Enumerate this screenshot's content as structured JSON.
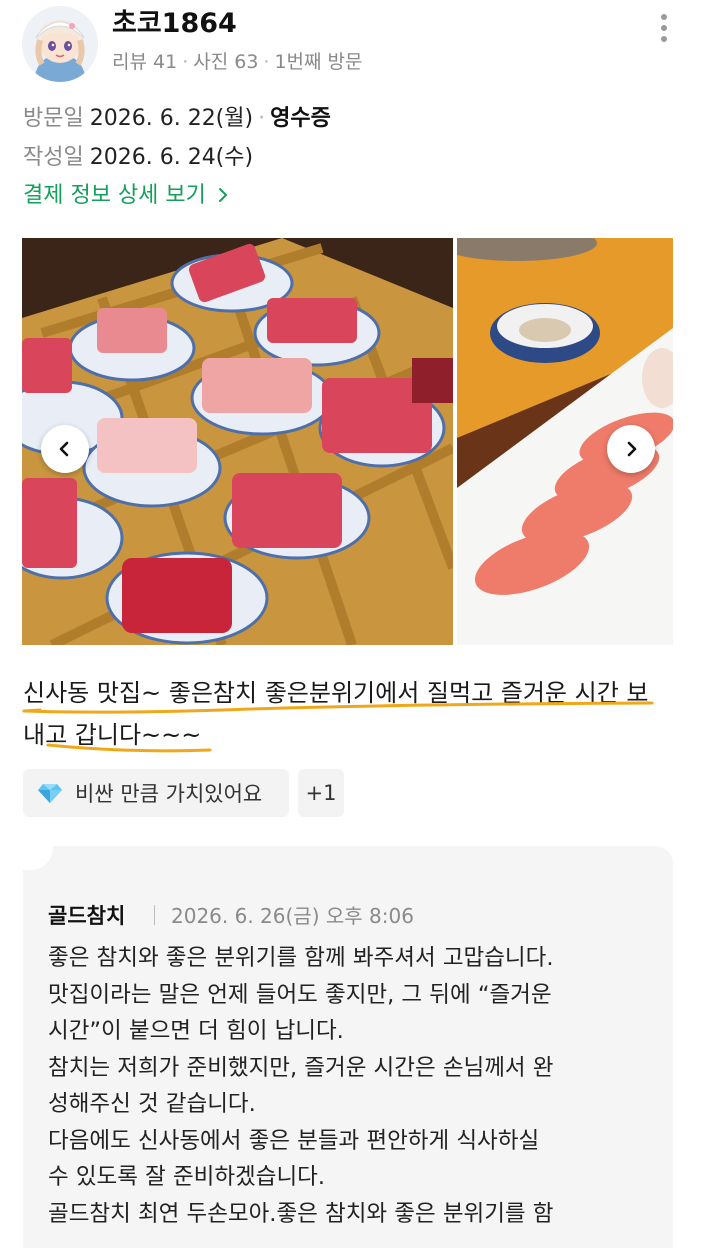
{
  "profile": {
    "username": "초코1864",
    "reviews": "리뷰 41",
    "photos": "사진 63",
    "visit_count": "1번째 방문"
  },
  "visit": {
    "visit_label": "방문일",
    "visit_date": "2026. 6. 22(월)",
    "receipt": "영수증",
    "written_label": "작성일",
    "written_date": "2026. 6. 24(수)",
    "payment_link": "결제 정보 상세 보기"
  },
  "photos": {
    "count_shown": 2,
    "items": [
      "tuna-sashimi-platter",
      "tuna-sushi-plate"
    ]
  },
  "review": {
    "text": "신사동 맛집~ 좋은참치 좋은분위기에서 질먹고 즐거운 시간 보내고 갑니다~~~",
    "underline_color": "#f0a81a"
  },
  "tags": {
    "keyword_icon": "diamond-icon",
    "keyword": "비싼 만큼 가치있어요",
    "more": "+1"
  },
  "reply": {
    "owner": "골드참치",
    "date": "2026. 6. 26(금) 오후 8:06",
    "lines": [
      "좋은 참치와 좋은 분위기를 함께 봐주셔서 고맙습니다.",
      "맛집이라는 말은 언제 들어도 좋지만, 그 뒤에 “즐거운",
      "시간”이 붙으면 더 힘이 납니다.",
      "참치는 저희가 준비했지만, 즐거운 시간은 손님께서 완",
      "성해주신 것 같습니다.",
      "다음에도 신사동에서 좋은 분들과 편안하게 식사하실",
      "수 있도록 잘 준비하겠습니다.",
      "골드참치 최연 두손모아.좋은 참치와 좋은 분위기를 함"
    ]
  },
  "colors": {
    "link_green": "#12a05a",
    "meta_gray": "#8a8a8a"
  }
}
